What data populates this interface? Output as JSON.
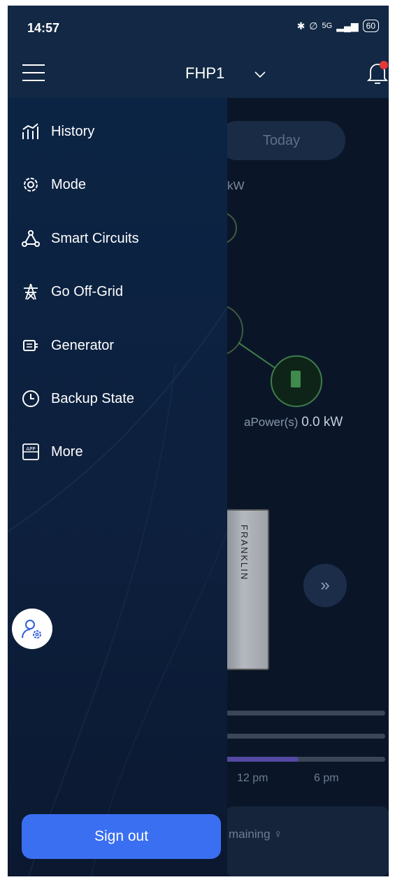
{
  "status_bar": {
    "time": "14:57",
    "network": "5G",
    "battery": "60"
  },
  "header": {
    "site_name": "FHP1",
    "menu_icon": "hamburger-icon",
    "dropdown_icon": "chevron-down-icon",
    "notification_icon": "bell-icon",
    "notification_dot_color": "#e53935"
  },
  "background": {
    "period_label": "Today",
    "unit_fragment": "kW",
    "apower_label": "aPower(s)",
    "apower_value": "0.0 kW",
    "device_brand": "FRANKLIN",
    "next_icon": "double-chevron-right-icon",
    "time_labels": [
      "12 pm",
      "6 pm"
    ],
    "remaining_fragment": "maining ♀"
  },
  "drawer": {
    "items": [
      {
        "label": "History",
        "icon": "history-chart-icon"
      },
      {
        "label": "Mode",
        "icon": "gear-icon"
      },
      {
        "label": "Smart Circuits",
        "icon": "smart-circuits-icon"
      },
      {
        "label": "Go Off-Grid",
        "icon": "power-tower-icon"
      },
      {
        "label": "Generator",
        "icon": "generator-icon"
      },
      {
        "label": "Backup State",
        "icon": "clock-icon"
      },
      {
        "label": "More",
        "icon": "app-icon"
      }
    ],
    "user_settings_icon": "user-settings-icon",
    "sign_out_label": "Sign out",
    "accent_color": "#3a6ff2"
  }
}
